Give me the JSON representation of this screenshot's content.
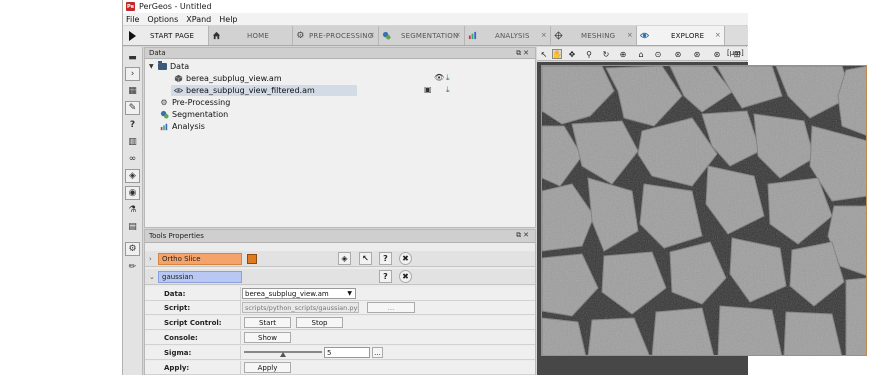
{
  "window": {
    "app_icon": "Pe",
    "title": "PerGeos - Untitled"
  },
  "menu": [
    "File",
    "Options",
    "XPand",
    "Help"
  ],
  "workrooms": {
    "start_label": "START PAGE",
    "tabs": [
      {
        "label": "HOME",
        "icon": "home-icon"
      },
      {
        "label": "PRE-PROCESSING",
        "icon": "gears-icon"
      },
      {
        "label": "SEGMENTATION",
        "icon": "segmentation-icon"
      },
      {
        "label": "ANALYSIS",
        "icon": "chart-icon"
      },
      {
        "label": "MESHING",
        "icon": "mesh-icon"
      },
      {
        "label": "EXPLORE",
        "icon": "eye-icon",
        "active": true
      }
    ],
    "close_glyph": "×"
  },
  "data_panel": {
    "title": "Data",
    "tree": [
      {
        "label": "Data",
        "level": 0,
        "icon": "folder-icon",
        "expanded": true
      },
      {
        "label": "berea_subplug_view.am",
        "level": 1,
        "icon": "cube-icon"
      },
      {
        "label": "berea_subplug_view_filtered.am",
        "level": 1,
        "icon": "eye-closed-icon",
        "selected": true
      },
      {
        "label": "Pre-Processing",
        "level": 0,
        "icon": "gears-icon"
      },
      {
        "label": "Segmentation",
        "level": 0,
        "icon": "segmentation-icon"
      },
      {
        "label": "Analysis",
        "level": 0,
        "icon": "chart-icon"
      }
    ]
  },
  "tools_panel": {
    "title": "Tools Properties",
    "ortho_slice_label": "Ortho Slice",
    "gaussian_label": "gaussian",
    "help_glyph": "?",
    "properties": {
      "data_label": "Data:",
      "data_value": "berea_subplug_view.am",
      "script_label": "Script:",
      "script_value": "scripts/python_scripts/gaussian.pyscro",
      "browse_label": "...",
      "script_control_label": "Script Control:",
      "start_label": "Start",
      "stop_label": "Stop",
      "console_label": "Console:",
      "show_label": "Show",
      "sigma_label": "Sigma:",
      "sigma_value": "5",
      "sigma_browse": "...",
      "apply_row_label": "Apply:",
      "apply_button": "Apply"
    }
  },
  "viewer": {
    "units_label": "[µm]"
  },
  "colors": {
    "ortho_slice": "#f4a46a",
    "gaussian": "#b8c8f2",
    "frame": "#c08b4a"
  }
}
